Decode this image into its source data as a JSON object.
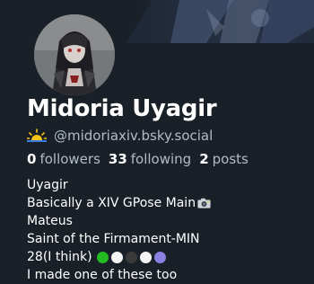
{
  "profile": {
    "display_name": "Midoria Uyagir",
    "handle": "@midoriaxiv.bsky.social",
    "handle_icon": "sunrise-icon",
    "avatar_icon": "avatar-character-art"
  },
  "stats": {
    "followers_count": "0",
    "followers_label": "followers",
    "following_count": "33",
    "following_label": "following",
    "posts_count": "2",
    "posts_label": "posts"
  },
  "bio": {
    "line1": "Uyagir",
    "line2": "Basically a XIV GPose Main",
    "line2_icon": "camera-icon",
    "line3": "Mateus",
    "line4": "Saint of the Firmament-MIN",
    "line5": "28(I think)",
    "line5_dots": [
      "#22bb22",
      "#f4f4f4",
      "#3a3a3a",
      "#f4f4f4",
      "#8b7fe0"
    ],
    "line6": "I made one of these too"
  },
  "colors": {
    "background": "#1a2028",
    "secondary_text": "#b1bcc8",
    "primary_text": "#ffffff"
  }
}
